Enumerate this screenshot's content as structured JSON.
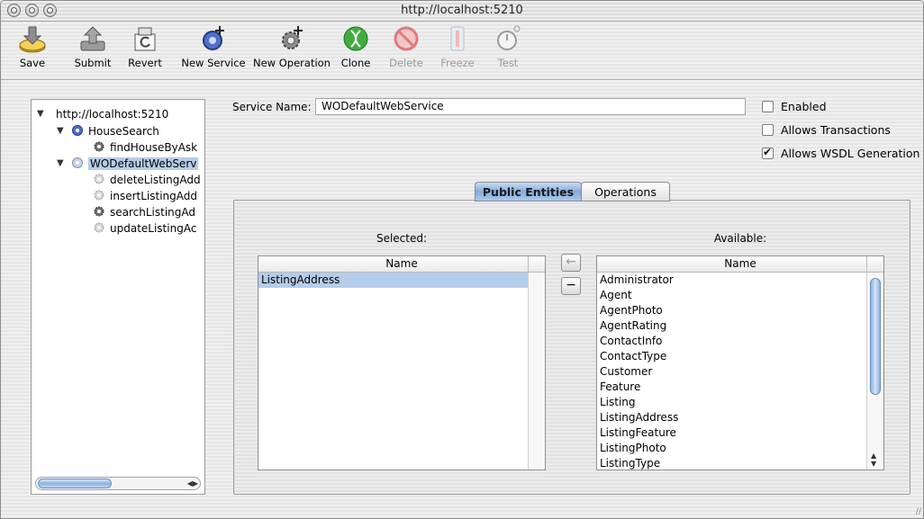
{
  "window": {
    "title": "http://localhost:5210"
  },
  "toolbar": {
    "save": "Save",
    "submit": "Submit",
    "revert": "Revert",
    "new_service": "New Service",
    "new_operation": "New Operation",
    "clone": "Clone",
    "delete": "Delete",
    "freeze": "Freeze",
    "test": "Test"
  },
  "tree": {
    "root": "http://localhost:5210",
    "items": [
      {
        "label": "HouseSearch"
      },
      {
        "label": "findHouseByAsk"
      },
      {
        "label": "WODefaultWebServ"
      },
      {
        "label": "deleteListingAdd"
      },
      {
        "label": "insertListingAdd"
      },
      {
        "label": "searchListingAd"
      },
      {
        "label": "updateListingAc"
      }
    ]
  },
  "service": {
    "name_label": "Service Name:",
    "name_value": "WODefaultWebService",
    "enabled_label": "Enabled",
    "enabled": false,
    "transactions_label": "Allows Transactions",
    "transactions": false,
    "wsdl_label": "Allows WSDL Generation",
    "wsdl": true
  },
  "tabs": {
    "public_entities": "Public Entities",
    "operations": "Operations",
    "active": "Public Entities"
  },
  "selected": {
    "title": "Selected:",
    "column": "Name",
    "rows": [
      "ListingAddress"
    ]
  },
  "available": {
    "title": "Available:",
    "column": "Name",
    "rows": [
      "Administrator",
      "Agent",
      "AgentPhoto",
      "AgentRating",
      "ContactInfo",
      "ContactType",
      "Customer",
      "Feature",
      "Listing",
      "ListingAddress",
      "ListingFeature",
      "ListingPhoto",
      "ListingType"
    ]
  },
  "buttons": {
    "add_symbol": "←",
    "remove_symbol": "−"
  },
  "colors": {
    "selection": "#b5cdea",
    "aqua_blue": "#86acde"
  }
}
